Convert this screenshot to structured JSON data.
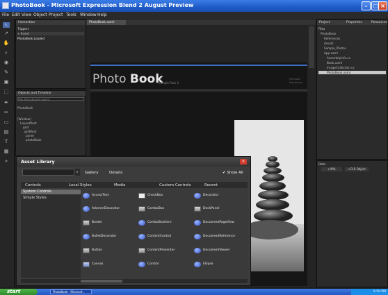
{
  "window": {
    "title": "PhotoBook - Microsoft Expression Blend 2 August Preview"
  },
  "menu": [
    "File",
    "Edit",
    "View",
    "Object",
    "Project",
    "Tools",
    "Window",
    "Help"
  ],
  "interaction": {
    "header": "Interaction",
    "document_tab": "PhotoBook.xaml",
    "triggers_label": "Triggers",
    "trigger_event": "+ Event",
    "trigger_item": "PhotoBook.Loaded",
    "objects_label": "Objects and Timeline",
    "search_placeholder": "(No Storyboard open)",
    "tree": [
      "PhotoBook",
      "[Window]",
      "LayoutRoot",
      "grid",
      "gridRoot",
      "panel",
      "photoBook"
    ]
  },
  "stage": {
    "heading_main": "Photo",
    "heading_bold": "Book",
    "subtitle": "Sample Pack 2",
    "corner_text1": "Microsoft",
    "corner_text2": "Expression"
  },
  "asset_library": {
    "title": "Asset Library",
    "view_buttons": [
      "Gallery",
      "Details"
    ],
    "show_all": "Show All",
    "tabs": [
      "Controls",
      "Local Styles",
      "Media",
      "Custom Controls",
      "Recent"
    ],
    "categories": [
      "System Controls",
      "Simple Styles"
    ],
    "items": [
      {
        "label": "AccessText",
        "icon": "oval-icon"
      },
      {
        "label": "CheckBox",
        "icon": "checkbox-icon"
      },
      {
        "label": "Decorator",
        "icon": "oval-icon"
      },
      {
        "label": "AdornerDecorator",
        "icon": "oval-icon"
      },
      {
        "label": "ComboBox",
        "icon": "combobox-icon"
      },
      {
        "label": "DockPanel",
        "icon": "dockpanel-icon"
      },
      {
        "label": "Border",
        "icon": "border-icon"
      },
      {
        "label": "ComboBoxItem",
        "icon": "oval-icon"
      },
      {
        "label": "DocumentPageView",
        "icon": "oval-icon"
      },
      {
        "label": "BulletDecorator",
        "icon": "oval-icon"
      },
      {
        "label": "ContentControl",
        "icon": "oval-icon"
      },
      {
        "label": "DocumentReference",
        "icon": "oval-icon"
      },
      {
        "label": "Button",
        "icon": "button-icon"
      },
      {
        "label": "ContentPresenter",
        "icon": "contentpresenter-icon"
      },
      {
        "label": "DocumentViewer",
        "icon": "oval-icon"
      },
      {
        "label": "Canvas",
        "icon": "canvas-icon"
      },
      {
        "label": "Control",
        "icon": "oval-icon"
      },
      {
        "label": "Ellipse",
        "icon": "oval-icon"
      }
    ]
  },
  "right_panel": {
    "tabs": [
      "Project",
      "Properties",
      "Resources"
    ],
    "files_label": "Files",
    "tree": [
      "PhotoBook",
      "References",
      "Assets",
      "Sample_Photos",
      "App.xaml",
      "AssemblyInfo.cs",
      "Book.xaml",
      "ImageCollection.cs",
      "PhotoBook.xaml"
    ],
    "data_label": "Data",
    "data_buttons": [
      "+XML",
      "+CLR Object"
    ]
  },
  "taskbar": {
    "start": "start",
    "task": "PhotoBook - Microsof...",
    "clock": "5:59 PM"
  },
  "colors": {
    "titlebar": "#1f5bc7",
    "accent": "#3e7bd8",
    "close": "#d13b2b"
  }
}
